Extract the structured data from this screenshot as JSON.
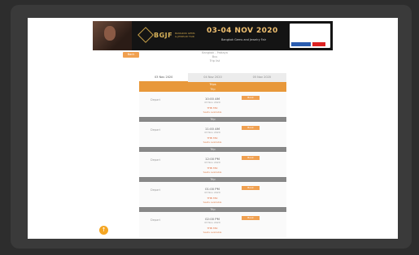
{
  "ad": {
    "brand": "BGJF",
    "brand_sub": "BANGKOK GEMS & JEWELRY FAIR",
    "date": "03-04 NOV 2020",
    "tagline": "Bangkok Gems and Jewelry Fair"
  },
  "back_label": "Back",
  "route": {
    "line1": "Bangkok - Pattaya",
    "line2": "Bus",
    "line3": "Trip list"
  },
  "tabs": [
    {
      "label": "03 Nov 2020"
    },
    {
      "label": "04 Nov 2020"
    },
    {
      "label": "05 Nov 2020"
    }
  ],
  "columns": {
    "header": "Trips"
  },
  "days": [
    {
      "header": "Trip",
      "loc": "Depart",
      "time": "10:00 AM",
      "date": "03 Nov 2020",
      "price": "THB 350",
      "seats": "Seats available",
      "book": "Book"
    },
    {
      "header": "Trip",
      "loc": "Depart",
      "time": "11:00 AM",
      "date": "03 Nov 2020",
      "price": "THB 350",
      "seats": "Seats available",
      "book": "Book"
    },
    {
      "header": "Trip",
      "loc": "Depart",
      "time": "12:00 PM",
      "date": "03 Nov 2020",
      "price": "THB 350",
      "seats": "Seats available",
      "book": "Book"
    },
    {
      "header": "Trip",
      "loc": "Depart",
      "time": "01:00 PM",
      "date": "03 Nov 2020",
      "price": "THB 350",
      "seats": "Seats available",
      "book": "Book"
    },
    {
      "header": "Trip",
      "loc": "Depart",
      "time": "02:00 PM",
      "date": "03 Nov 2020",
      "price": "THB 350",
      "seats": "Seats available",
      "book": "Book"
    }
  ],
  "fab_icon": "up-arrow-icon"
}
